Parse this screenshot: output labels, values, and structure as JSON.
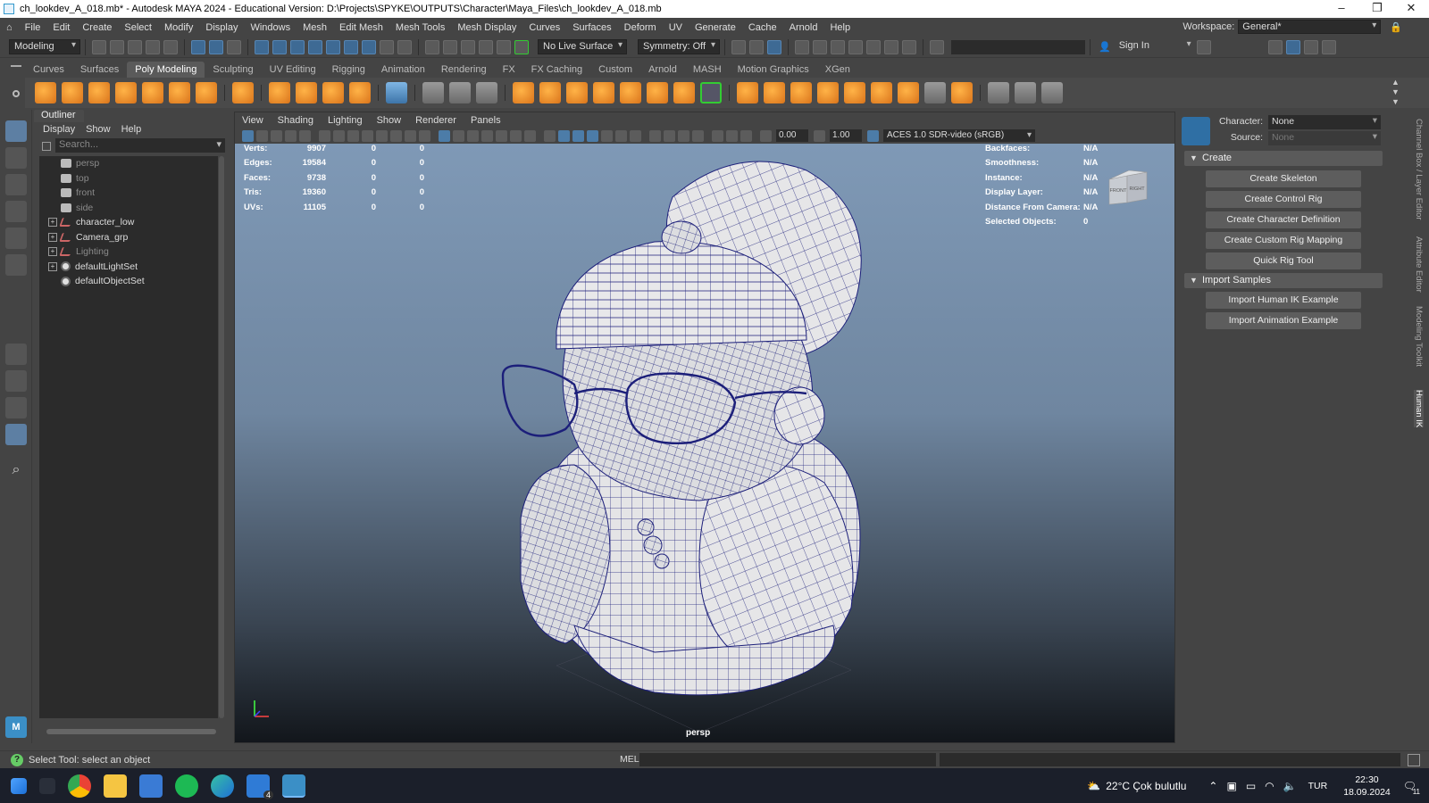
{
  "window": {
    "title": "ch_lookdev_A_018.mb* - Autodesk MAYA 2024 - Educational Version: D:\\Projects\\SPYKE\\OUTPUTS\\Character\\Maya_Files\\ch_lookdev_A_018.mb"
  },
  "menubar": {
    "items": [
      "File",
      "Edit",
      "Create",
      "Select",
      "Modify",
      "Display",
      "Windows",
      "Mesh",
      "Edit Mesh",
      "Mesh Tools",
      "Mesh Display",
      "Curves",
      "Surfaces",
      "Deform",
      "UV",
      "Generate",
      "Cache",
      "Arnold",
      "Help"
    ],
    "workspace_label": "Workspace:",
    "workspace_value": "General*"
  },
  "statusline": {
    "mode": "Modeling",
    "live_surface": "No Live Surface",
    "symmetry": "Symmetry: Off",
    "sign_in": "Sign In"
  },
  "shelf": {
    "tabs": [
      "Curves",
      "Surfaces",
      "Poly Modeling",
      "Sculpting",
      "UV Editing",
      "Rigging",
      "Animation",
      "Rendering",
      "FX",
      "FX Caching",
      "Custom",
      "Arnold",
      "MASH",
      "Motion Graphics",
      "XGen"
    ],
    "active_tab": "Poly Modeling"
  },
  "outliner": {
    "title": "Outliner",
    "menu": [
      "Display",
      "Show",
      "Help"
    ],
    "search_placeholder": "Search...",
    "items": [
      {
        "label": "persp",
        "type": "camera",
        "dim": true,
        "expandable": false
      },
      {
        "label": "top",
        "type": "camera",
        "dim": true,
        "expandable": false
      },
      {
        "label": "front",
        "type": "camera",
        "dim": true,
        "expandable": false
      },
      {
        "label": "side",
        "type": "camera",
        "dim": true,
        "expandable": false
      },
      {
        "label": "character_low",
        "type": "group",
        "dim": false,
        "expandable": true
      },
      {
        "label": "Camera_grp",
        "type": "group",
        "dim": false,
        "expandable": true
      },
      {
        "label": "Lighting",
        "type": "group",
        "dim": true,
        "expandable": true
      },
      {
        "label": "defaultLightSet",
        "type": "set",
        "dim": false,
        "expandable": true
      },
      {
        "label": "defaultObjectSet",
        "type": "set",
        "dim": false,
        "expandable": false
      }
    ]
  },
  "viewport": {
    "menu": [
      "View",
      "Shading",
      "Lighting",
      "Show",
      "Renderer",
      "Panels"
    ],
    "exposure": "0.00",
    "gamma": "1.00",
    "color_space": "ACES 1.0 SDR-video (sRGB)",
    "camera_label": "persp",
    "hud_left": [
      {
        "label": "Verts:",
        "v1": "9907",
        "v2": "0",
        "v3": "0"
      },
      {
        "label": "Edges:",
        "v1": "19584",
        "v2": "0",
        "v3": "0"
      },
      {
        "label": "Faces:",
        "v1": "9738",
        "v2": "0",
        "v3": "0"
      },
      {
        "label": "Tris:",
        "v1": "19360",
        "v2": "0",
        "v3": "0"
      },
      {
        "label": "UVs:",
        "v1": "11105",
        "v2": "0",
        "v3": "0"
      }
    ],
    "hud_right": [
      {
        "label": "Backfaces:",
        "value": "N/A"
      },
      {
        "label": "Smoothness:",
        "value": "N/A"
      },
      {
        "label": "Instance:",
        "value": "N/A"
      },
      {
        "label": "Display Layer:",
        "value": "N/A"
      },
      {
        "label": "Distance From Camera:",
        "value": "N/A"
      },
      {
        "label": "Selected Objects:",
        "value": "0"
      }
    ],
    "viewcube": {
      "front": "FRONT",
      "right": "RIGHT"
    }
  },
  "hik": {
    "character_label": "Character:",
    "character_value": "None",
    "source_label": "Source:",
    "source_value": "None",
    "create_section": "Create",
    "create_buttons": [
      "Create Skeleton",
      "Create Control Rig",
      "Create Character Definition",
      "Create Custom Rig Mapping",
      "Quick Rig Tool"
    ],
    "import_section": "Import Samples",
    "import_buttons": [
      "Import Human IK Example",
      "Import Animation Example"
    ]
  },
  "side_tabs": [
    "Channel Box / Layer Editor",
    "Attribute Editor",
    "Modeling Toolkit",
    "Human IK"
  ],
  "helpline": {
    "text": "Select Tool: select an object",
    "cmd_type": "MEL"
  },
  "taskbar": {
    "weather": "22°C  Çok bulutlu",
    "lang": "TUR",
    "time": "22:30",
    "date": "18.09.2024",
    "mail_badge": "4",
    "notif": "11"
  },
  "colors": {
    "accent": "#5d7fa3",
    "shelf_orange": "#f09a2c",
    "wire": "#1c1f7a"
  }
}
